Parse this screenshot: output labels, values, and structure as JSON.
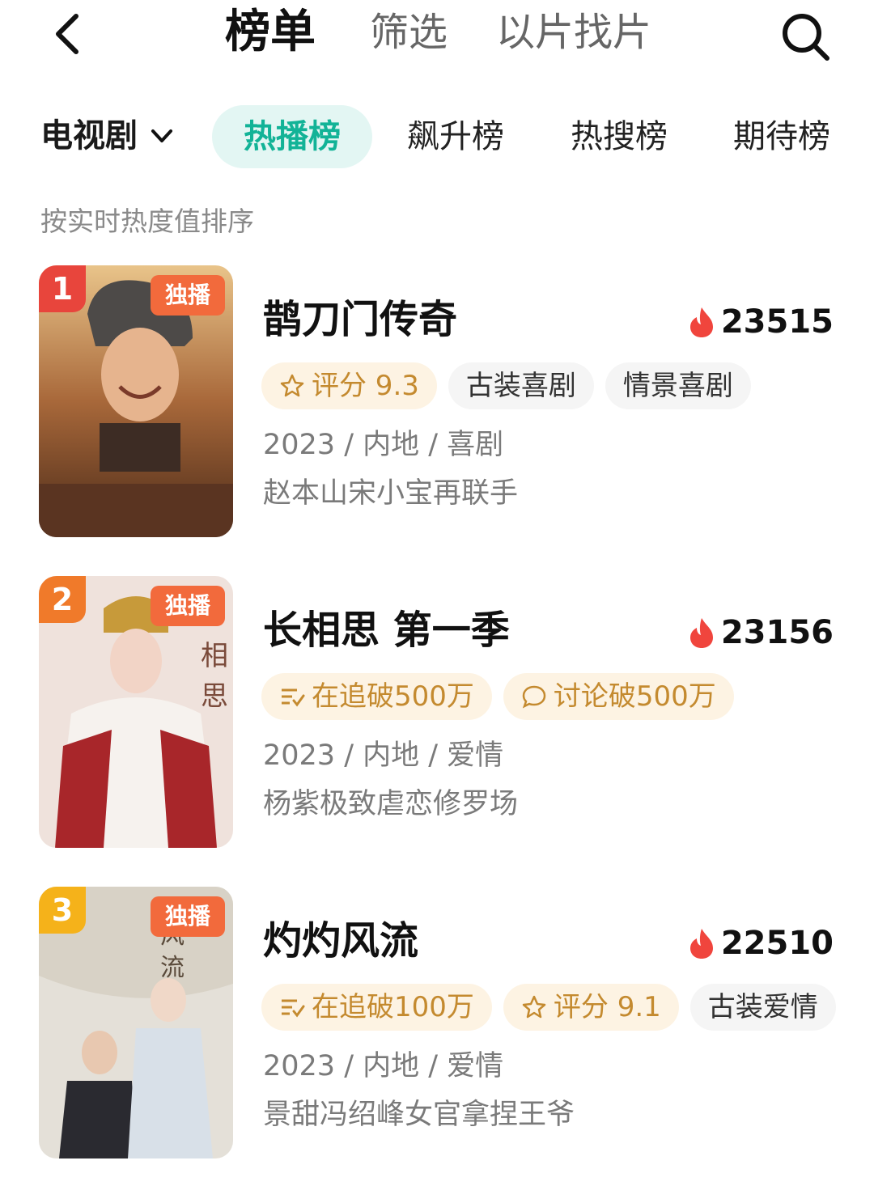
{
  "header": {
    "tabs": [
      "榜单",
      "筛选",
      "以片找片"
    ]
  },
  "category": {
    "selected": "电视剧",
    "rank_tabs": [
      "热播榜",
      "飙升榜",
      "热搜榜",
      "期待榜"
    ]
  },
  "sort_note": "按实时热度值排序",
  "items": [
    {
      "rank": "1",
      "badge": "独播",
      "title": "鹊刀门传奇",
      "heat": "23515",
      "tags": [
        {
          "icon": "star-icon",
          "text": "评分 9.3",
          "style": "warm"
        },
        {
          "text": "古装喜剧",
          "style": "grey"
        },
        {
          "text": "情景喜剧",
          "style": "grey"
        }
      ],
      "meta": "2023 / 内地 / 喜剧",
      "desc": "赵本山宋小宝再联手"
    },
    {
      "rank": "2",
      "badge": "独播",
      "title": "长相思 第一季",
      "heat": "23156",
      "tags": [
        {
          "icon": "list-check-icon",
          "text": "在追破500万",
          "style": "warm"
        },
        {
          "icon": "comment-icon",
          "text": "讨论破500万",
          "style": "warm"
        }
      ],
      "meta": "2023 / 内地 / 爱情",
      "desc": "杨紫极致虐恋修罗场"
    },
    {
      "rank": "3",
      "badge": "独播",
      "title": "灼灼风流",
      "heat": "22510",
      "tags": [
        {
          "icon": "list-check-icon",
          "text": "在追破100万",
          "style": "warm"
        },
        {
          "icon": "star-icon",
          "text": "评分 9.1",
          "style": "warm"
        },
        {
          "text": "古装爱情",
          "style": "grey"
        }
      ],
      "meta": "2023 / 内地 / 爱情",
      "desc": "景甜冯绍峰女官拿捏王爷"
    }
  ],
  "colors": {
    "accent": "#12b397",
    "rank1": "#e8453c",
    "rank2": "#f07a2a",
    "rank3": "#f5b21a",
    "fire": "#f0453d"
  }
}
